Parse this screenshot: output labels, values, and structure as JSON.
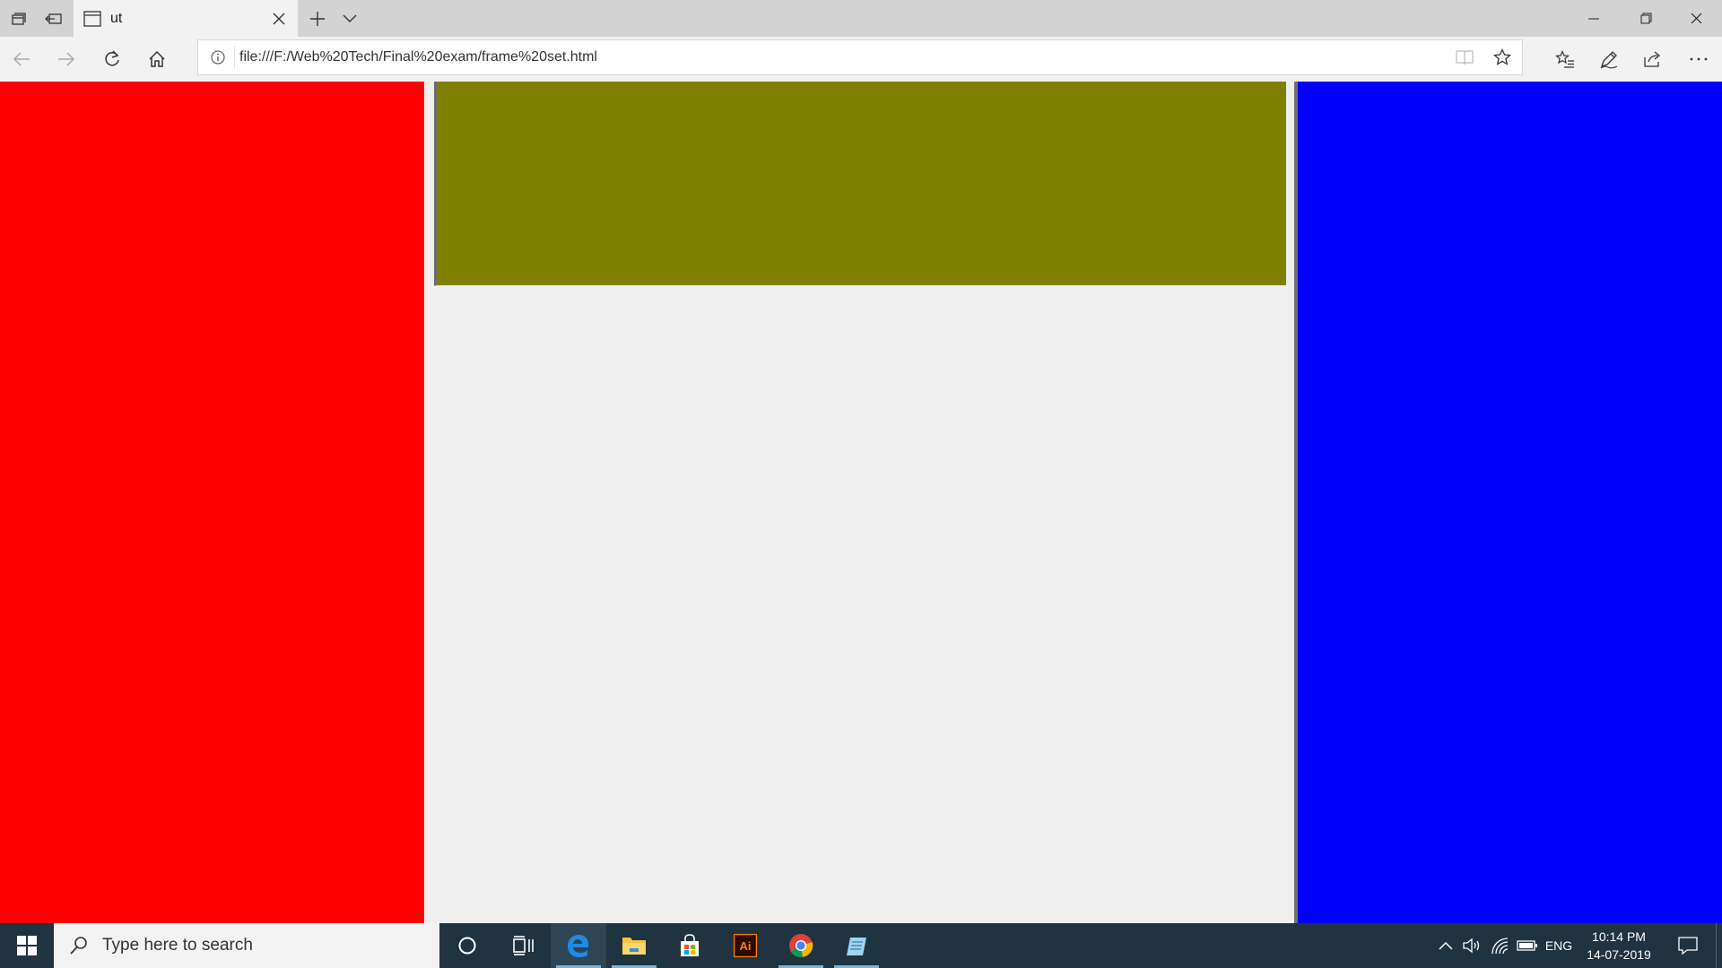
{
  "browser": {
    "tab": {
      "title": "ut"
    },
    "address": {
      "url": "file:///F:/Web%20Tech/Final%20exam/frame%20set.html"
    }
  },
  "frames": {
    "left_color": "#ff0000",
    "top_color": "#808000",
    "right_color": "#0000ff",
    "background_color": "#efefef"
  },
  "taskbar": {
    "search_placeholder": "Type here to search",
    "language": "ENG",
    "time": "10:14 PM",
    "date": "14-07-2019",
    "apps": [
      "cortana-icon",
      "task-view-icon",
      "edge-icon",
      "file-explorer-icon",
      "store-icon",
      "illustrator-icon",
      "chrome-icon",
      "notepad-icon"
    ]
  },
  "colors": {
    "taskbar_bg": "#1f3340",
    "tab_strip_bg": "#d3d3d3",
    "nav_bg": "#f2f2f2"
  }
}
